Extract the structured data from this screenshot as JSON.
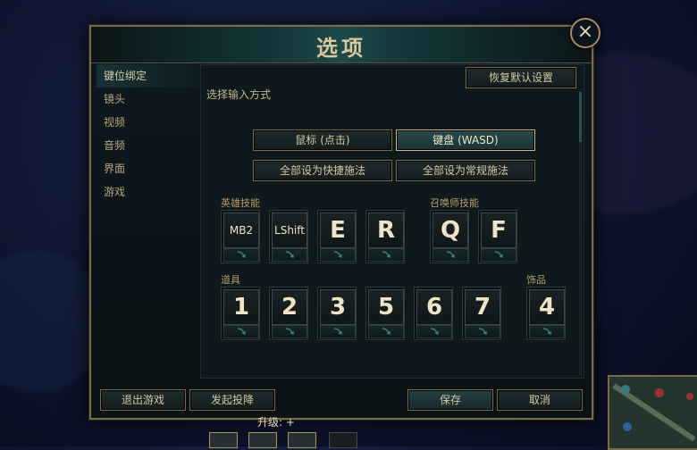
{
  "dialog": {
    "title": "选项"
  },
  "sidebar": {
    "items": [
      {
        "label": "键位绑定",
        "active": true
      },
      {
        "label": "镜头"
      },
      {
        "label": "视频"
      },
      {
        "label": "音频"
      },
      {
        "label": "界面"
      },
      {
        "label": "游戏"
      }
    ]
  },
  "content": {
    "reset_label": "恢复默认设置",
    "input_method_label": "选择输入方式",
    "mode_buttons": [
      {
        "label": "鼠标 (点击)",
        "selected": false
      },
      {
        "label": "键盘 (WASD)",
        "selected": true
      }
    ],
    "cast_buttons": [
      "全部设为快捷施法",
      "全部设为常规施法"
    ],
    "sections": {
      "hero_skills": "英雄技能",
      "summoner_skills": "召唤师技能",
      "items": "道具",
      "trinket": "饰品"
    },
    "hero_keys": [
      "MB2",
      "LShift",
      "E",
      "R"
    ],
    "summoner_keys": [
      "Q",
      "F"
    ],
    "item_keys": [
      "1",
      "2",
      "3",
      "5",
      "6",
      "7"
    ],
    "trinket_key": "4"
  },
  "footer": {
    "exit_label": "退出游戏",
    "surrender_label": "发起投降",
    "save_label": "保存",
    "cancel_label": "取消"
  },
  "hud": {
    "partial_text": "升级: +"
  },
  "colors": {
    "accent_gold": "#c7b57e",
    "panel_bg": "#0d191d",
    "selected_teal": "#2a4a4c"
  }
}
